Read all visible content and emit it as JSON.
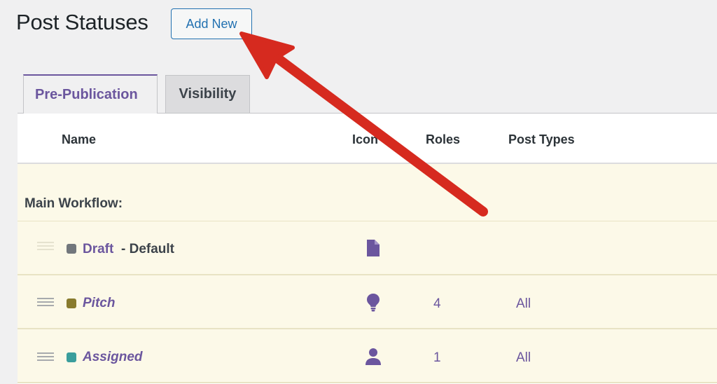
{
  "page": {
    "title": "Post Statuses",
    "add_new_label": "Add New"
  },
  "tabs": [
    {
      "label": "Pre-Publication",
      "active": true
    },
    {
      "label": "Visibility",
      "active": false
    }
  ],
  "table": {
    "columns": [
      "Name",
      "Icon",
      "Roles",
      "Post Types"
    ],
    "group_label": "Main Workflow:",
    "rows": [
      {
        "name": "Draft",
        "suffix": "- Default",
        "color": "#72777c",
        "icon": "document-icon",
        "roles": "",
        "post_types": ""
      },
      {
        "name": "Pitch",
        "suffix": "",
        "color": "#887b2e",
        "icon": "lightbulb-icon",
        "roles": "4",
        "post_types": "All"
      },
      {
        "name": "Assigned",
        "suffix": "",
        "color": "#3a9e9c",
        "icon": "person-icon",
        "roles": "1",
        "post_types": "All"
      }
    ]
  },
  "colors": {
    "accent": "#6b569e",
    "link": "#2271b1",
    "row_bg": "#fcf9e8",
    "annotation_arrow": "#d62a1f"
  }
}
